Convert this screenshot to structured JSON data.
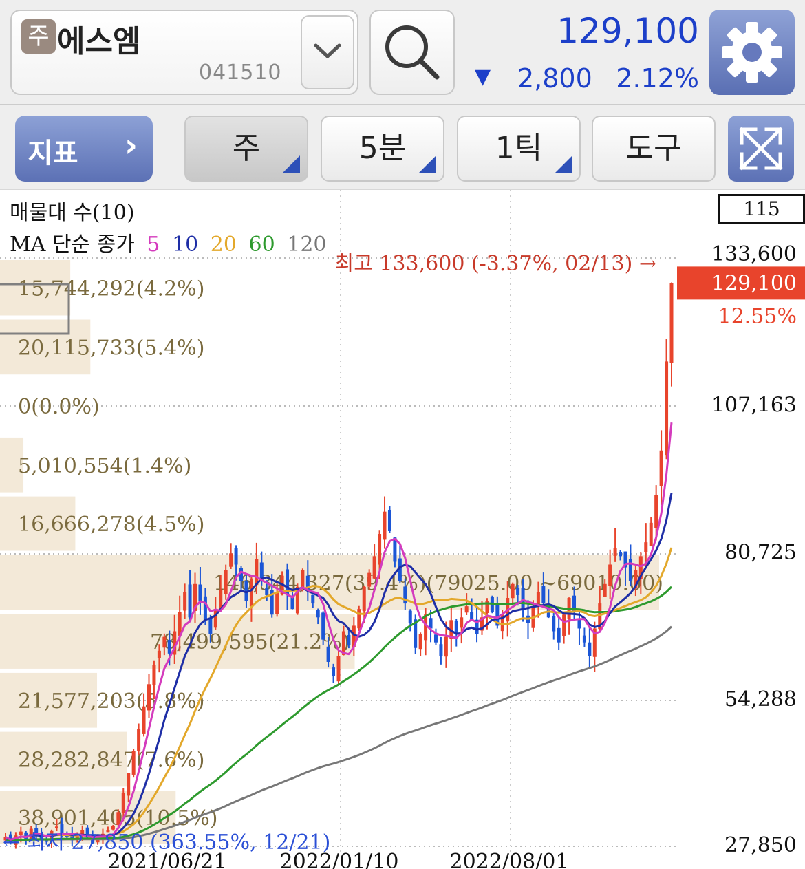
{
  "header": {
    "market_badge": "주",
    "stock_name": "에스엠",
    "stock_code": "041510",
    "price": "129,100",
    "change_direction": "down",
    "change_arrow": "▼",
    "change_value": "2,800",
    "change_pct": "2.12%",
    "icons": {
      "dropdown": "chevron-down-icon",
      "search": "search-icon",
      "settings": "gear-icon"
    }
  },
  "toolbar": {
    "indicator_label": "지표",
    "indicator_chevron": "›",
    "period_label": "주",
    "interval_label": "5분",
    "tick_label": "1틱",
    "tools_label": "도구",
    "expand_icon": "expand-icon"
  },
  "indicators": {
    "volume_profile_title": "매물대 수(10)",
    "ma_title": "MA 단순 종가",
    "ma_periods": [
      "5",
      "10",
      "20",
      "60",
      "120"
    ],
    "count_box": "115"
  },
  "colors": {
    "up": "#e8442c",
    "down": "#1c56d6",
    "ma5": "#d43bbd",
    "ma10": "#1e2ea6",
    "ma20": "#e3a82b",
    "ma60": "#2e9a2e",
    "ma120": "#777777",
    "volume_profile": "#f3e9d8",
    "price_tag": "#e8442c"
  },
  "chart_data": {
    "type": "candlestick",
    "title": "",
    "y_axis_labels": [
      "133,600",
      "107,163",
      "80,725",
      "54,288",
      "27,850"
    ],
    "ylim": [
      27850,
      133600
    ],
    "x_axis_labels": [
      "2021/06/21",
      "2022/01/10",
      "2022/08/01"
    ],
    "grid": true,
    "current_price_tag": "129,100",
    "current_change_pct": "12.55%",
    "high_annotation": "최고 133,600 (-3.37%, 02/13) →",
    "low_annotation": "← 최저 27,850 (363.55%, 12/21)",
    "volume_profile": [
      {
        "label": "15,744,292(4.2%)",
        "pct": 4.2,
        "low": 122900,
        "high": 133600
      },
      {
        "label": "20,115,733(5.4%)",
        "pct": 5.4,
        "low": 112300,
        "high": 122900
      },
      {
        "label": "0(0.0%)",
        "pct": 0.0,
        "low": 101700,
        "high": 112300
      },
      {
        "label": "5,010,554(1.4%)",
        "pct": 1.4,
        "low": 91100,
        "high": 101700
      },
      {
        "label": "16,666,278(4.5%)",
        "pct": 4.5,
        "low": 80600,
        "high": 91100
      },
      {
        "label": "146,344,327(39.4%)(79025.00 ~69010.00)",
        "pct": 39.4,
        "low": 70000,
        "high": 80600
      },
      {
        "label": "78,499,595(21.2%)",
        "pct": 21.2,
        "low": 59400,
        "high": 70000
      },
      {
        "label": "21,577,203(5.8%)",
        "pct": 5.8,
        "low": 48800,
        "high": 59400
      },
      {
        "label": "28,282,847(7.6%)",
        "pct": 7.6,
        "low": 38200,
        "high": 48800
      },
      {
        "label": "38,901,405(10.5%)",
        "pct": 10.5,
        "low": 27850,
        "high": 38200
      }
    ],
    "closes": [
      29500,
      28600,
      29800,
      30500,
      29200,
      31000,
      30200,
      29100,
      28700,
      30600,
      31400,
      30300,
      29500,
      28900,
      29800,
      30700,
      29700,
      28400,
      29200,
      30100,
      30800,
      31500,
      34000,
      37500,
      41000,
      45000,
      49000,
      53000,
      57000,
      60500,
      63000,
      65500,
      62500,
      66500,
      70000,
      73500,
      69000,
      75000,
      72000,
      68500,
      66000,
      70500,
      74000,
      77500,
      80500,
      78500,
      75500,
      72000,
      76000,
      79500,
      75500,
      73000,
      69500,
      73500,
      76500,
      73000,
      70500,
      74500,
      77500,
      74000,
      71500,
      69000,
      65000,
      61000,
      58500,
      62000,
      66500,
      64000,
      67500,
      70500,
      74500,
      77000,
      80000,
      84000,
      88000,
      84500,
      79000,
      75500,
      71500,
      68000,
      63500,
      66000,
      69500,
      67000,
      64500,
      62000,
      65500,
      68500,
      66000,
      69000,
      71000,
      68500,
      66000,
      69000,
      72000,
      70000,
      67500,
      69500,
      72500,
      75000,
      73000,
      70500,
      68000,
      71000,
      73500,
      71500,
      69000,
      66500,
      64500,
      69500,
      72500,
      70000,
      67000,
      64500,
      62000,
      67000,
      71500,
      75000,
      78500,
      81500,
      80000,
      78000,
      75500,
      77500,
      80000,
      82500,
      86000,
      91000,
      99000,
      115000,
      129100
    ]
  }
}
